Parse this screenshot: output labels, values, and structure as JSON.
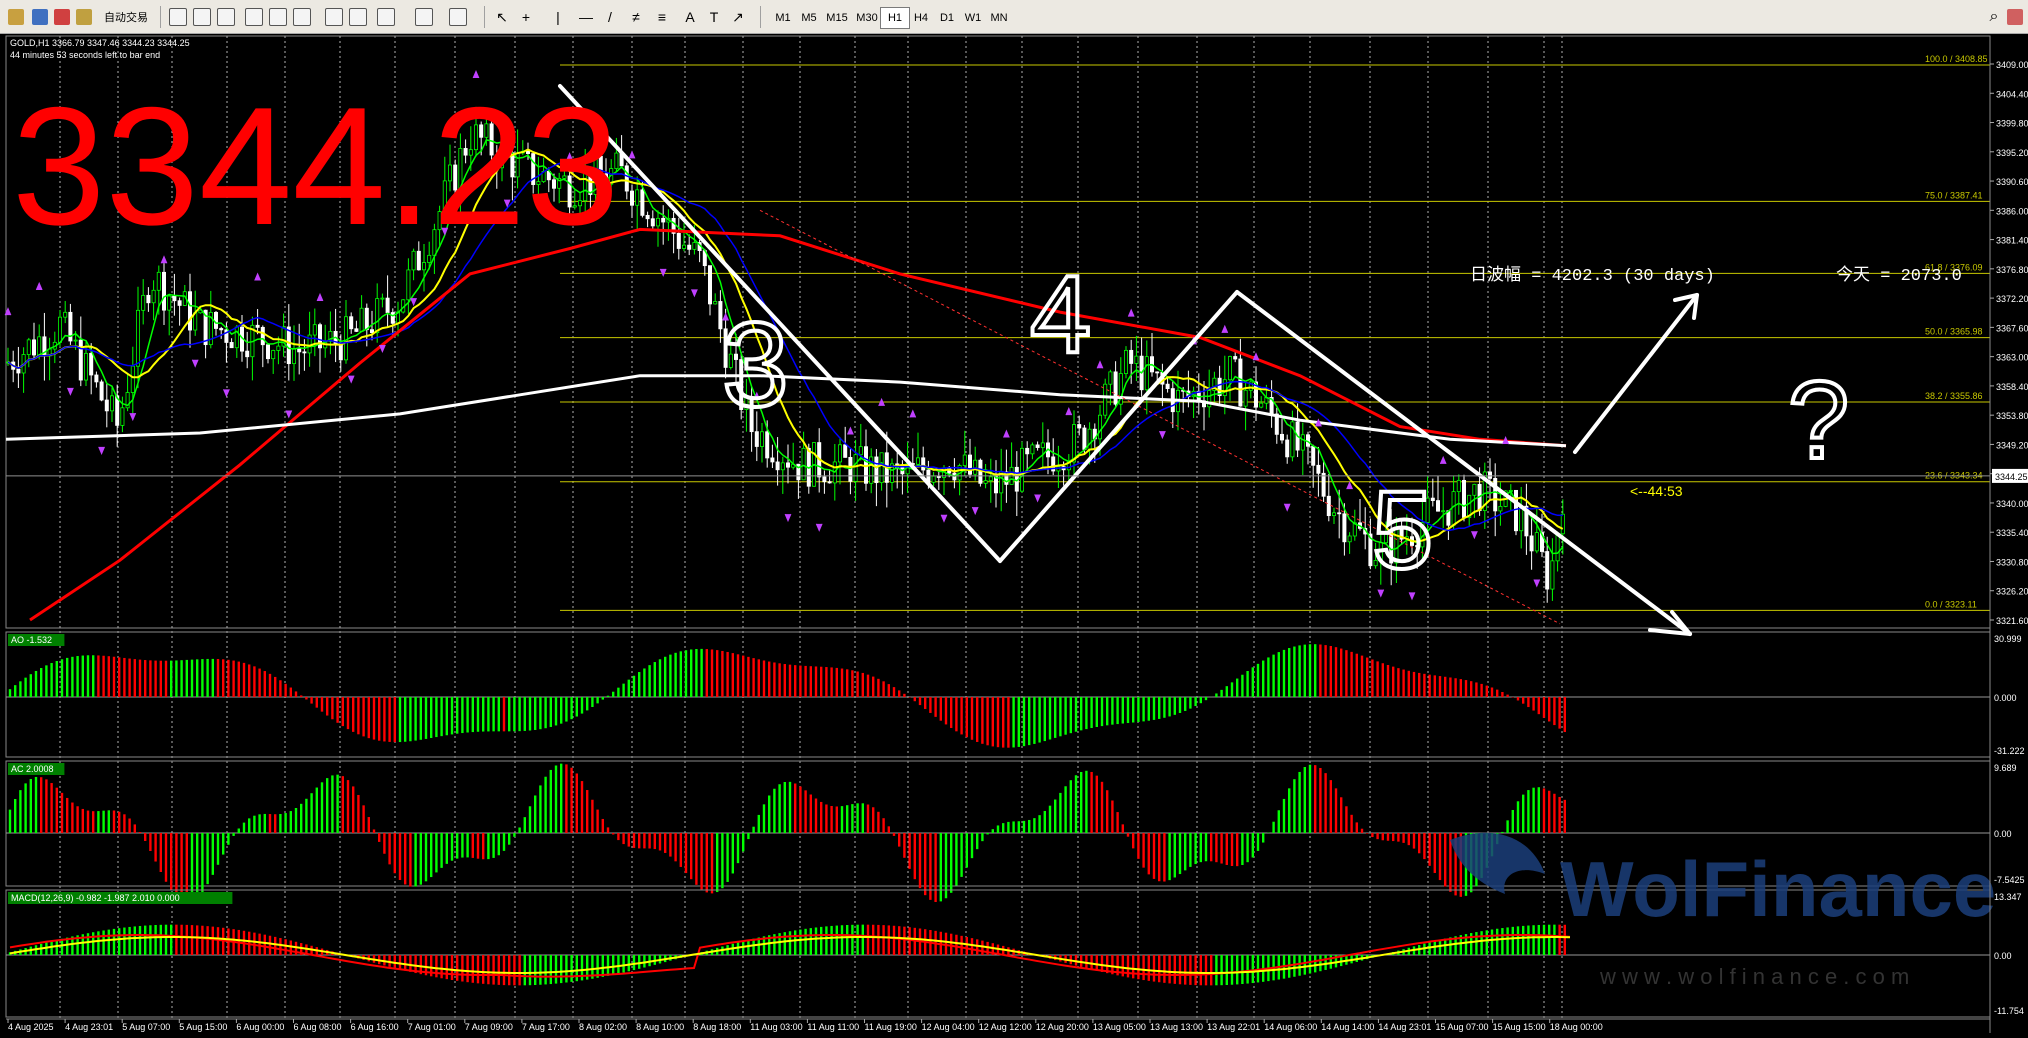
{
  "toolbar": {
    "auto_trade_label": "自动交易",
    "timeframes": [
      "M1",
      "M5",
      "M15",
      "M30",
      "H1",
      "H4",
      "D1",
      "W1",
      "MN"
    ],
    "active_timeframe": "H1"
  },
  "chart": {
    "symbol_line": "GOLD,H1  3366.79 3347.46 3344.23 3344.25",
    "countdown_line": "44 minutes 53 seconds left to bar end",
    "big_price": "3344.23",
    "range_text": "日波幅 = 4202.3  (30 days)",
    "today_text": "今天 = 2073.0",
    "bar_countdown": "<--44:53",
    "current_price_label": "3344.25",
    "price_axis": [
      "3409.00",
      "3404.40",
      "3399.80",
      "3395.20",
      "3390.60",
      "3386.00",
      "3381.40",
      "3376.80",
      "3372.20",
      "3367.60",
      "3363.00",
      "3358.40",
      "3353.80",
      "3349.20",
      "3344.25",
      "3340.00",
      "3335.40",
      "3330.80",
      "3326.20",
      "3321.60"
    ],
    "fib_levels": [
      {
        "label": "100.0  /  3408.85",
        "price": 3408.85
      },
      {
        "label": "75.0  /  3387.41",
        "price": 3387.41
      },
      {
        "label": "61.8  /  3376.09",
        "price": 3376.09
      },
      {
        "label": "50.0  /  3365.98",
        "price": 3365.98
      },
      {
        "label": "38.2  /  3355.86",
        "price": 3355.86
      },
      {
        "label": "23.6  /  3343.34",
        "price": 3343.34
      },
      {
        "label": "0.0  /  3323.11",
        "price": 3323.11
      }
    ],
    "time_axis": [
      "4 Aug 2025",
      "4 Aug 23:01",
      "5 Aug 07:00",
      "5 Aug 15:00",
      "6 Aug 00:00",
      "6 Aug 08:00",
      "6 Aug 16:00",
      "7 Aug 01:00",
      "7 Aug 09:00",
      "7 Aug 17:00",
      "8 Aug 02:00",
      "8 Aug 10:00",
      "8 Aug 18:00",
      "11 Aug 03:00",
      "11 Aug 11:00",
      "11 Aug 19:00",
      "12 Aug 04:00",
      "12 Aug 12:00",
      "12 Aug 20:00",
      "13 Aug 05:00",
      "13 Aug 13:00",
      "13 Aug 22:01",
      "14 Aug 06:00",
      "14 Aug 14:00",
      "14 Aug 23:01",
      "15 Aug 07:00",
      "15 Aug 15:00",
      "18 Aug 00:00"
    ],
    "annotations": [
      "3",
      "4",
      "5",
      "?"
    ],
    "watermark": "WolFinance",
    "watermark_url": "w w w . w o l f i n a n c e . c o m"
  },
  "indicators": {
    "ao": {
      "label": "AO -1.532",
      "max": "30.999",
      "zero": "0.000",
      "min": "-31.222"
    },
    "ac": {
      "label": "AC 2.0008",
      "max": "9.689",
      "zero": "0.00",
      "min": "-7.5425"
    },
    "macd": {
      "label": "MACD(12,26,9) -0.982 -1.987 2.010 0.000",
      "max": "13.347",
      "zero": "0.00",
      "min": "-11.754"
    }
  },
  "colors": {
    "bull": "#00ff00",
    "bear": "#ff0000",
    "fib": "#c8c800",
    "grid": "#ffffff",
    "ma_red": "#ff0000",
    "ma_blue": "#0000ff",
    "ma_yellow": "#ffff00",
    "ma_green": "#00ff00"
  }
}
